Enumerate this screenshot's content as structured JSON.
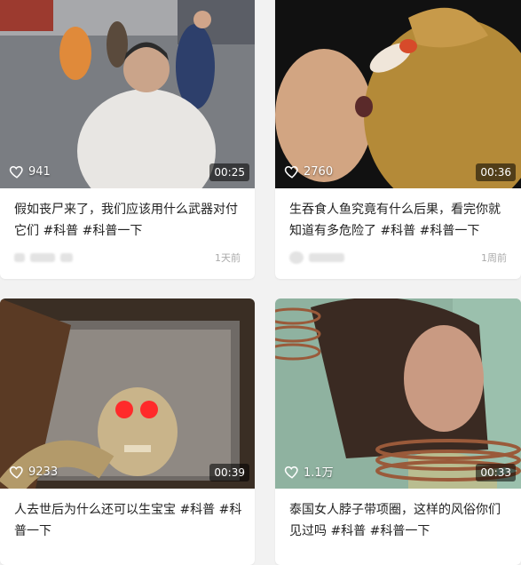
{
  "feed": {
    "cards": [
      {
        "likes": "941",
        "duration": "00:25",
        "title": "假如丧尸来了，我们应该用什么武器对付它们 #科普 #科普一下",
        "time": "1天前"
      },
      {
        "likes": "2760",
        "duration": "00:36",
        "title": "生吞食人鱼究竟有什么后果，看完你就知道有多危险了 #科普 #科普一下",
        "time": "1周前"
      },
      {
        "likes": "9233",
        "duration": "00:39",
        "title": "人去世后为什么还可以生宝宝 #科普 #科普一下"
      },
      {
        "likes": "1.1万",
        "duration": "00:33",
        "title": "泰国女人脖子带项圈，这样的风俗你们见过吗 #科普 #科普一下"
      }
    ]
  },
  "icons": {
    "like": "heart-outline-icon"
  }
}
